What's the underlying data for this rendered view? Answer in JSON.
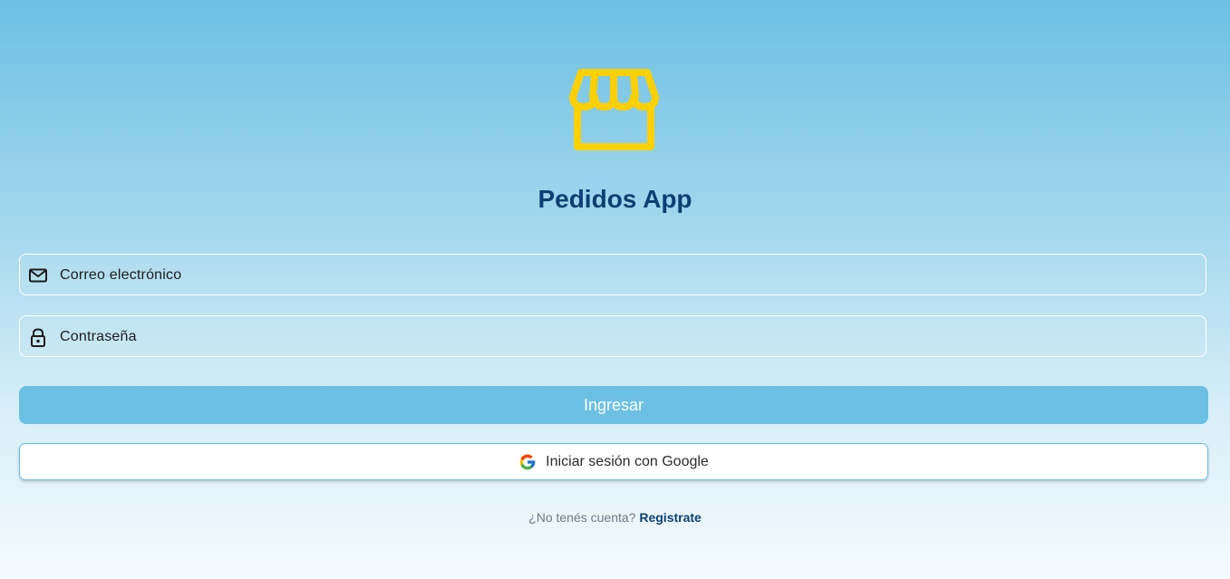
{
  "app": {
    "title": "Pedidos App",
    "logo_icon": "storefront-icon",
    "logo_color": "#ffd000",
    "title_color": "#0d3f74"
  },
  "form": {
    "email": {
      "placeholder": "Correo electrónico",
      "icon": "mail-icon"
    },
    "password": {
      "placeholder": "Contraseña",
      "icon": "lock-icon"
    },
    "submit_label": "Ingresar",
    "submit_color": "#6bc0e4",
    "google_label": "Iniciar sesión con Google",
    "google_icon": "google-icon"
  },
  "footer": {
    "question": "¿No tenés cuenta?",
    "link": "Registrate"
  }
}
